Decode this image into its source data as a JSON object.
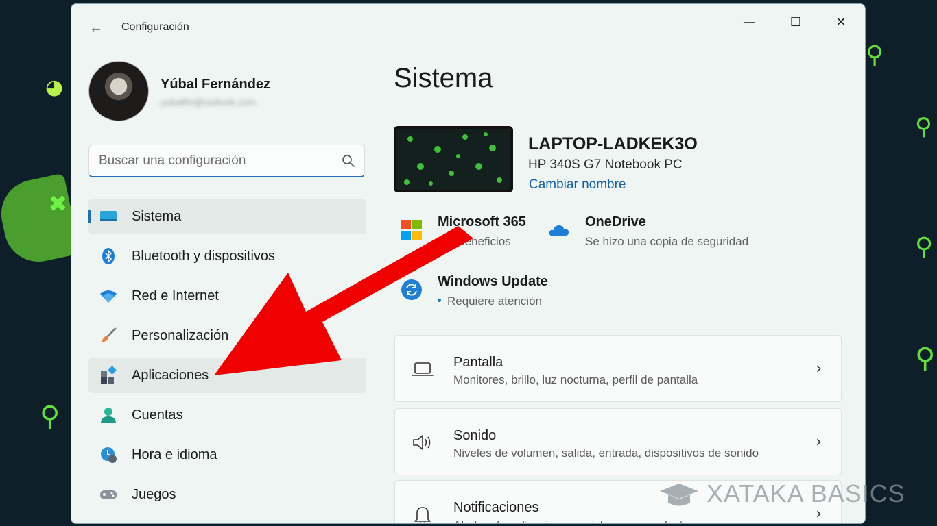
{
  "window": {
    "title": "Configuración",
    "controls": {
      "minimize": "—",
      "maximize": "☐",
      "close": "✕"
    }
  },
  "profile": {
    "name": "Yúbal Fernández",
    "email": "yubalfm@outlook.com"
  },
  "search": {
    "placeholder": "Buscar una configuración"
  },
  "nav": {
    "items": [
      {
        "label": "Sistema",
        "icon": "system-icon"
      },
      {
        "label": "Bluetooth y dispositivos",
        "icon": "bluetooth-icon"
      },
      {
        "label": "Red e Internet",
        "icon": "wifi-icon"
      },
      {
        "label": "Personalización",
        "icon": "brush-icon"
      },
      {
        "label": "Aplicaciones",
        "icon": "apps-icon"
      },
      {
        "label": "Cuentas",
        "icon": "account-icon"
      },
      {
        "label": "Hora e idioma",
        "icon": "clock-globe-icon"
      },
      {
        "label": "Juegos",
        "icon": "gamepad-icon"
      }
    ]
  },
  "main": {
    "title": "Sistema",
    "device": {
      "name": "LAPTOP-LADKEK3O",
      "model": "HP 340S G7 Notebook PC",
      "rename": "Cambiar nombre"
    },
    "quick": {
      "m365": {
        "title": "Microsoft 365",
        "sub": "Ver beneficios"
      },
      "onedrive": {
        "title": "OneDrive",
        "sub": "Se hizo una copia de seguridad"
      },
      "update": {
        "title": "Windows Update",
        "sub": "Requiere atención"
      }
    },
    "cards": [
      {
        "title": "Pantalla",
        "sub": "Monitores, brillo, luz nocturna, perfil de pantalla"
      },
      {
        "title": "Sonido",
        "sub": "Niveles de volumen, salida, entrada, dispositivos de sonido"
      },
      {
        "title": "Notificaciones",
        "sub": "Alertas de aplicaciones y sistema, no molestar"
      }
    ]
  },
  "watermark": "XATAKA BASICS",
  "colors": {
    "accent": "#1f6fb6",
    "arrow": "#f00000",
    "window_bg": "#eef5f3"
  }
}
